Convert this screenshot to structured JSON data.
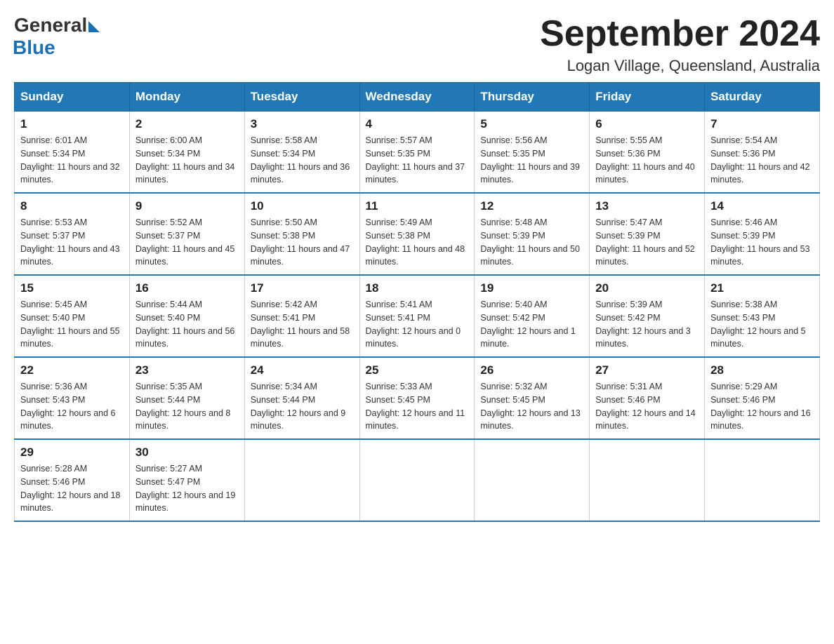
{
  "logo": {
    "general": "General",
    "blue": "Blue"
  },
  "title": {
    "month_year": "September 2024",
    "location": "Logan Village, Queensland, Australia"
  },
  "weekdays": [
    "Sunday",
    "Monday",
    "Tuesday",
    "Wednesday",
    "Thursday",
    "Friday",
    "Saturday"
  ],
  "weeks": [
    [
      {
        "day": "1",
        "sunrise": "6:01 AM",
        "sunset": "5:34 PM",
        "daylight": "11 hours and 32 minutes."
      },
      {
        "day": "2",
        "sunrise": "6:00 AM",
        "sunset": "5:34 PM",
        "daylight": "11 hours and 34 minutes."
      },
      {
        "day": "3",
        "sunrise": "5:58 AM",
        "sunset": "5:34 PM",
        "daylight": "11 hours and 36 minutes."
      },
      {
        "day": "4",
        "sunrise": "5:57 AM",
        "sunset": "5:35 PM",
        "daylight": "11 hours and 37 minutes."
      },
      {
        "day": "5",
        "sunrise": "5:56 AM",
        "sunset": "5:35 PM",
        "daylight": "11 hours and 39 minutes."
      },
      {
        "day": "6",
        "sunrise": "5:55 AM",
        "sunset": "5:36 PM",
        "daylight": "11 hours and 40 minutes."
      },
      {
        "day": "7",
        "sunrise": "5:54 AM",
        "sunset": "5:36 PM",
        "daylight": "11 hours and 42 minutes."
      }
    ],
    [
      {
        "day": "8",
        "sunrise": "5:53 AM",
        "sunset": "5:37 PM",
        "daylight": "11 hours and 43 minutes."
      },
      {
        "day": "9",
        "sunrise": "5:52 AM",
        "sunset": "5:37 PM",
        "daylight": "11 hours and 45 minutes."
      },
      {
        "day": "10",
        "sunrise": "5:50 AM",
        "sunset": "5:38 PM",
        "daylight": "11 hours and 47 minutes."
      },
      {
        "day": "11",
        "sunrise": "5:49 AM",
        "sunset": "5:38 PM",
        "daylight": "11 hours and 48 minutes."
      },
      {
        "day": "12",
        "sunrise": "5:48 AM",
        "sunset": "5:39 PM",
        "daylight": "11 hours and 50 minutes."
      },
      {
        "day": "13",
        "sunrise": "5:47 AM",
        "sunset": "5:39 PM",
        "daylight": "11 hours and 52 minutes."
      },
      {
        "day": "14",
        "sunrise": "5:46 AM",
        "sunset": "5:39 PM",
        "daylight": "11 hours and 53 minutes."
      }
    ],
    [
      {
        "day": "15",
        "sunrise": "5:45 AM",
        "sunset": "5:40 PM",
        "daylight": "11 hours and 55 minutes."
      },
      {
        "day": "16",
        "sunrise": "5:44 AM",
        "sunset": "5:40 PM",
        "daylight": "11 hours and 56 minutes."
      },
      {
        "day": "17",
        "sunrise": "5:42 AM",
        "sunset": "5:41 PM",
        "daylight": "11 hours and 58 minutes."
      },
      {
        "day": "18",
        "sunrise": "5:41 AM",
        "sunset": "5:41 PM",
        "daylight": "12 hours and 0 minutes."
      },
      {
        "day": "19",
        "sunrise": "5:40 AM",
        "sunset": "5:42 PM",
        "daylight": "12 hours and 1 minute."
      },
      {
        "day": "20",
        "sunrise": "5:39 AM",
        "sunset": "5:42 PM",
        "daylight": "12 hours and 3 minutes."
      },
      {
        "day": "21",
        "sunrise": "5:38 AM",
        "sunset": "5:43 PM",
        "daylight": "12 hours and 5 minutes."
      }
    ],
    [
      {
        "day": "22",
        "sunrise": "5:36 AM",
        "sunset": "5:43 PM",
        "daylight": "12 hours and 6 minutes."
      },
      {
        "day": "23",
        "sunrise": "5:35 AM",
        "sunset": "5:44 PM",
        "daylight": "12 hours and 8 minutes."
      },
      {
        "day": "24",
        "sunrise": "5:34 AM",
        "sunset": "5:44 PM",
        "daylight": "12 hours and 9 minutes."
      },
      {
        "day": "25",
        "sunrise": "5:33 AM",
        "sunset": "5:45 PM",
        "daylight": "12 hours and 11 minutes."
      },
      {
        "day": "26",
        "sunrise": "5:32 AM",
        "sunset": "5:45 PM",
        "daylight": "12 hours and 13 minutes."
      },
      {
        "day": "27",
        "sunrise": "5:31 AM",
        "sunset": "5:46 PM",
        "daylight": "12 hours and 14 minutes."
      },
      {
        "day": "28",
        "sunrise": "5:29 AM",
        "sunset": "5:46 PM",
        "daylight": "12 hours and 16 minutes."
      }
    ],
    [
      {
        "day": "29",
        "sunrise": "5:28 AM",
        "sunset": "5:46 PM",
        "daylight": "12 hours and 18 minutes."
      },
      {
        "day": "30",
        "sunrise": "5:27 AM",
        "sunset": "5:47 PM",
        "daylight": "12 hours and 19 minutes."
      },
      null,
      null,
      null,
      null,
      null
    ]
  ]
}
